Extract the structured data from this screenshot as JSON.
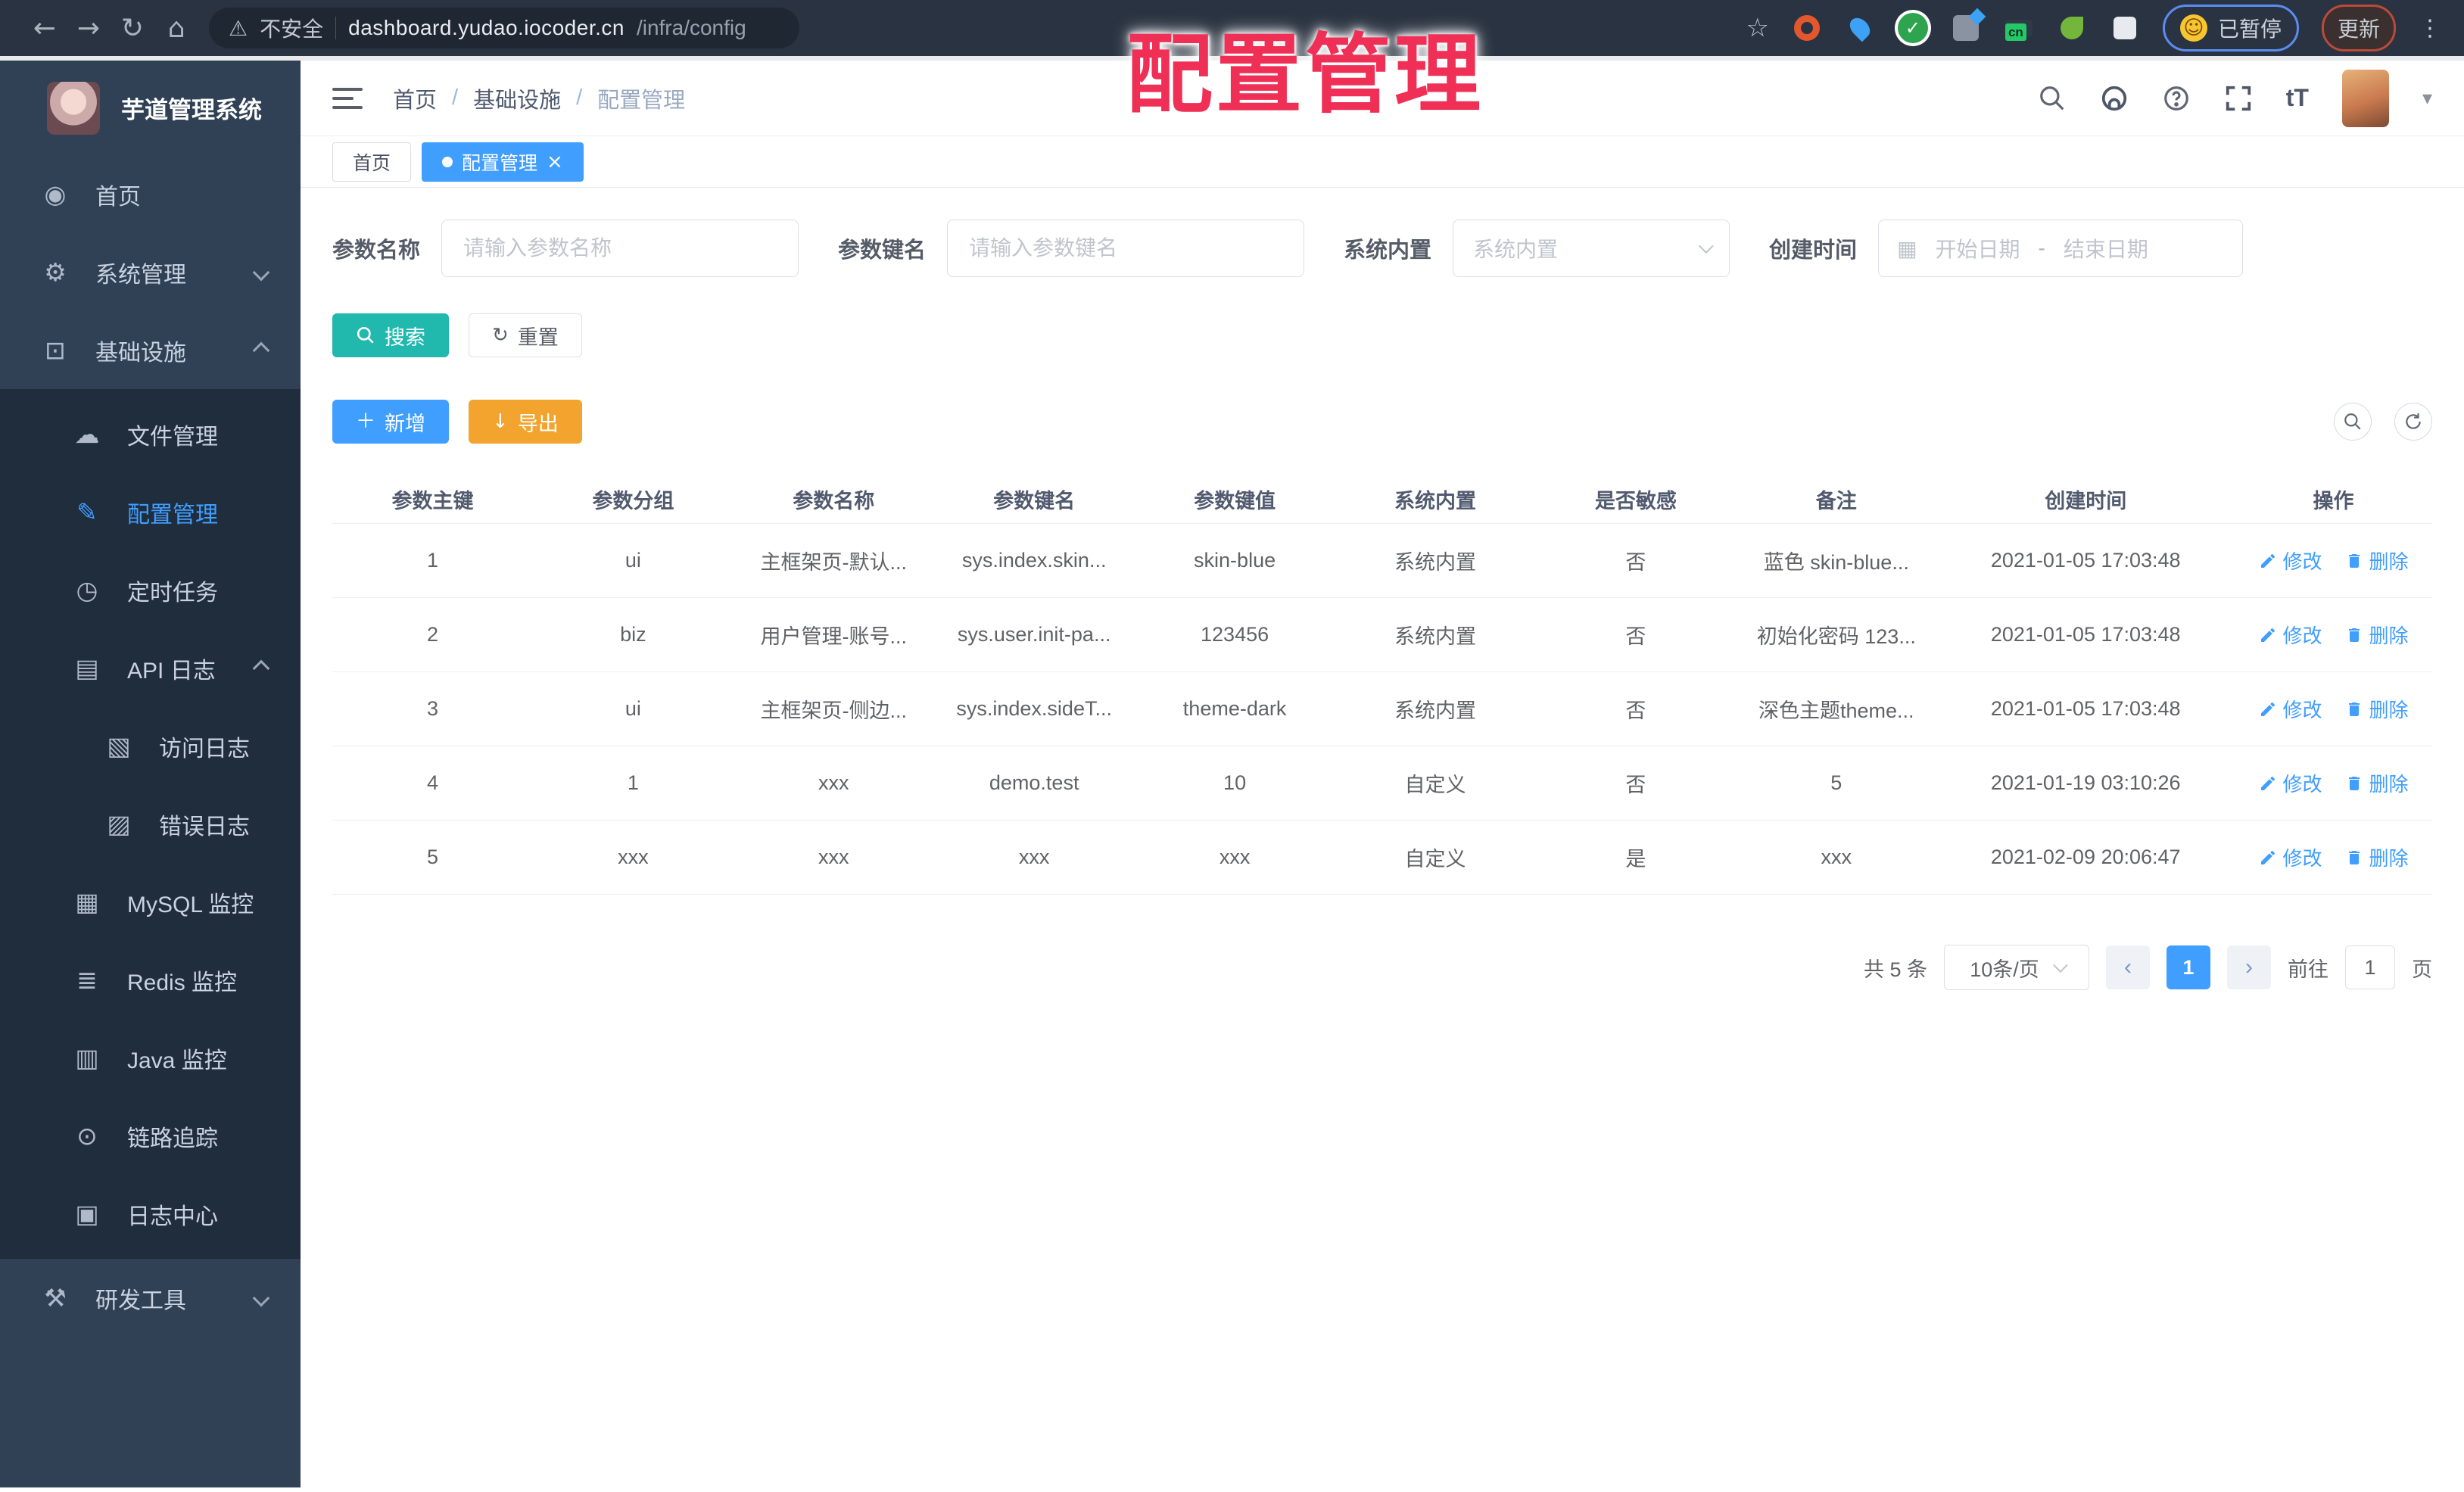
{
  "browser": {
    "security_label": "不安全",
    "url_host": "dashboard.yudao.iocoder.cn",
    "url_path": "/infra/config",
    "paused_badge": "已暂停",
    "update_button": "更新",
    "extension_cn_badge": "cn"
  },
  "overlay_title": "配置管理",
  "colors": {
    "accent_blue": "#409eff",
    "search_teal": "#21b9ad",
    "export_orange": "#f2a42e",
    "sidebar_bg": "#304156",
    "submenu_bg": "#1f2d3d",
    "overlay_red": "#ef2f55"
  },
  "icons": {
    "back": "←",
    "forward": "→",
    "reload": "↻",
    "home": "⌂",
    "warning": "⚠",
    "star": "☆",
    "menu_dots": "⋮",
    "caret_down": "▾",
    "face": "☺",
    "calendar": "▦",
    "search": "⌕",
    "plus": "＋",
    "download": "↓",
    "reset": "↻",
    "close": "×",
    "dashboard": "◉",
    "gear": "⚙",
    "monitor": "⊡",
    "cloud": "☁",
    "edit_square": "✎",
    "clock": "◷",
    "api_log": "▤",
    "access_log": "▧",
    "error_log": "▨",
    "mysql": "▦",
    "redis": "≣",
    "java": "▥",
    "eye": "⊙",
    "log_center": "▣",
    "toolbox": "⚒"
  },
  "sidebar": {
    "app_title": "芋道管理系统",
    "items": [
      {
        "label": "首页"
      },
      {
        "label": "系统管理"
      },
      {
        "label": "基础设施"
      },
      {
        "label": "文件管理"
      },
      {
        "label": "配置管理"
      },
      {
        "label": "定时任务"
      },
      {
        "label": "API 日志"
      },
      {
        "label": "访问日志"
      },
      {
        "label": "错误日志"
      },
      {
        "label": "MySQL 监控"
      },
      {
        "label": "Redis 监控"
      },
      {
        "label": "Java 监控"
      },
      {
        "label": "链路追踪"
      },
      {
        "label": "日志中心"
      },
      {
        "label": "研发工具"
      }
    ]
  },
  "header": {
    "breadcrumb": [
      "首页",
      "基础设施",
      "配置管理"
    ],
    "separator": "/"
  },
  "tabs": [
    {
      "label": "首页"
    },
    {
      "label": "配置管理"
    }
  ],
  "filters": {
    "name_label": "参数名称",
    "name_placeholder": "请输入参数名称",
    "key_label": "参数键名",
    "key_placeholder": "请输入参数键名",
    "type_label": "系统内置",
    "type_placeholder": "系统内置",
    "date_label": "创建时间",
    "date_start": "开始日期",
    "date_separator": "-",
    "date_end": "结束日期",
    "search_label": "搜索",
    "reset_label": "重置"
  },
  "toolbar": {
    "add_label": "新增",
    "export_label": "导出"
  },
  "table": {
    "headers": [
      "参数主键",
      "参数分组",
      "参数名称",
      "参数键名",
      "参数键值",
      "系统内置",
      "是否敏感",
      "备注",
      "创建时间",
      "操作"
    ],
    "edit_label": "修改",
    "delete_label": "删除",
    "rows": [
      {
        "id": "1",
        "group": "ui",
        "name": "主框架页-默认...",
        "key": "sys.index.skin...",
        "value": "skin-blue",
        "builtin": "系统内置",
        "sensitive": "否",
        "remark": "蓝色 skin-blue...",
        "created": "2021-01-05 17:03:48"
      },
      {
        "id": "2",
        "group": "biz",
        "name": "用户管理-账号...",
        "key": "sys.user.init-pa...",
        "value": "123456",
        "builtin": "系统内置",
        "sensitive": "否",
        "remark": "初始化密码 123...",
        "created": "2021-01-05 17:03:48"
      },
      {
        "id": "3",
        "group": "ui",
        "name": "主框架页-侧边...",
        "key": "sys.index.sideT...",
        "value": "theme-dark",
        "builtin": "系统内置",
        "sensitive": "否",
        "remark": "深色主题theme...",
        "created": "2021-01-05 17:03:48"
      },
      {
        "id": "4",
        "group": "1",
        "name": "xxx",
        "key": "demo.test",
        "value": "10",
        "builtin": "自定义",
        "sensitive": "否",
        "remark": "5",
        "created": "2021-01-19 03:10:26"
      },
      {
        "id": "5",
        "group": "xxx",
        "name": "xxx",
        "key": "xxx",
        "value": "xxx",
        "builtin": "自定义",
        "sensitive": "是",
        "remark": "xxx",
        "created": "2021-02-09 20:06:47"
      }
    ]
  },
  "pagination": {
    "total": "共 5 条",
    "page_size": "10条/页",
    "current_page": "1",
    "goto_label": "前往",
    "goto_value": "1",
    "unit_label": "页"
  }
}
